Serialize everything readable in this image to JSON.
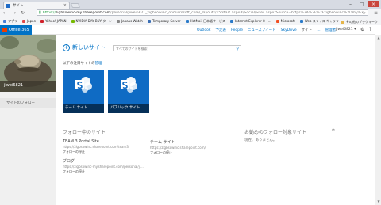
{
  "browser": {
    "tab_title": "サイト",
    "url_https": "https://",
    "url_host": "zigbsowinc-my.sharepoint.com",
    "url_path": "/personal/jiwei6821_zigbsowinc_onmicrosoft_com/_layouts/15/start.aspx#/Social/Sites.aspx?Source=https%3A%2F%2Fzigbsowinc%2Dmy%2E",
    "bookmarks": [
      "アプリ",
      "Japan",
      "Yahoo! JAPAN",
      "NVIDIA DAY BUY ターン",
      "Japaas Watch",
      "Temporary Server",
      "HotMail 日本語サービス",
      "Internet Explorer 8 - …",
      "Microsoft",
      "Web スライス ギャラリー"
    ],
    "bookmark_other": "その他のブックマーク"
  },
  "suite": {
    "brand": "Office 365",
    "nav": [
      "Outlook",
      "予定表",
      "People",
      "ニュースフィード",
      "SkyDrive",
      "サイト",
      "…",
      "管理者"
    ],
    "user": "jiwei6821 ▾"
  },
  "profile": {
    "name": "jiwei6821",
    "followers_label": "サイトのフォロー"
  },
  "main": {
    "new_site_label": "新しいサイト",
    "search_placeholder": "すべてのサイトを検索",
    "promoted_prefix": "以下の注目サイトの",
    "promoted_link": "管理",
    "tiles": [
      {
        "label": "チーム サイト"
      },
      {
        "label": "パブリック サイト"
      }
    ],
    "followed_heading": "フォロー中のサイト",
    "followed_sites": [
      {
        "title": "TEAM 3 Portal Site",
        "url": "https://zigbsowinc.sharepoint.com/team3",
        "action": "フォローの停止"
      },
      {
        "title": "チーム サイト",
        "url": "https://zigbsowinc.sharepoint.com/",
        "action": "フォローの停止"
      },
      {
        "title": "ブログ",
        "url": "https://zigbsowinc-my.sharepoint.com/personal/ji...",
        "action": "フォローの停止"
      }
    ],
    "suggested_heading": "お勧めのフォロー対象サイト",
    "suggested_empty": "現在、ありません。"
  },
  "colors": {
    "accent": "#0072c6",
    "tile": "#0f6bc4",
    "office_orange": "#eb3c00"
  }
}
